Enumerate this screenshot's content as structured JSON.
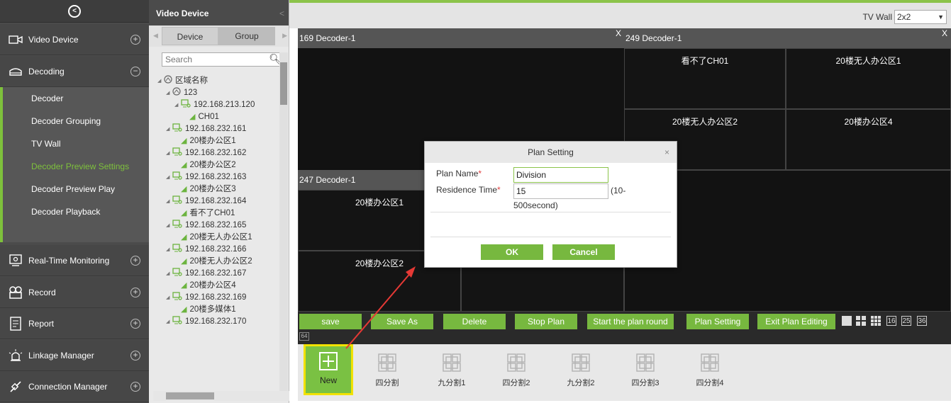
{
  "sidebar": {
    "top_icon": "circle-chevron-icon",
    "sections": [
      {
        "label": "Video Device",
        "icon": "video-device-icon",
        "toggle": "+"
      },
      {
        "label": "Decoding",
        "icon": "decoding-icon",
        "toggle": "−"
      },
      {
        "label": "Real-Time Monitoring",
        "icon": "monitor-icon",
        "toggle": "+"
      },
      {
        "label": "Record",
        "icon": "record-icon",
        "toggle": "+"
      },
      {
        "label": "Report",
        "icon": "report-icon",
        "toggle": "+"
      },
      {
        "label": "Linkage Manager",
        "icon": "linkage-icon",
        "toggle": "+"
      },
      {
        "label": "Connection Manager",
        "icon": "connection-icon",
        "toggle": "+"
      }
    ],
    "sub_items": [
      "Decoder",
      "Decoder Grouping",
      "TV Wall",
      "Decoder Preview Settings",
      "Decoder Preview Play",
      "Decoder Playback"
    ],
    "active_sub": "Decoder Preview Settings",
    "accent_color": "#7ec13c"
  },
  "tree_panel": {
    "title": "Video Device",
    "tabs": [
      "Device",
      "Group"
    ],
    "search_placeholder": "Search",
    "nodes": [
      {
        "label": "区域名称",
        "level": 0,
        "type": "area"
      },
      {
        "label": "123",
        "level": 1,
        "type": "area"
      },
      {
        "label": "192.168.213.120",
        "level": 2,
        "type": "device"
      },
      {
        "label": "CH01",
        "level": 3,
        "type": "camera"
      },
      {
        "label": "192.168.232.161",
        "level": 1,
        "type": "device"
      },
      {
        "label": "20楼办公区1",
        "level": 2,
        "type": "camera"
      },
      {
        "label": "192.168.232.162",
        "level": 1,
        "type": "device"
      },
      {
        "label": "20楼办公区2",
        "level": 2,
        "type": "camera"
      },
      {
        "label": "192.168.232.163",
        "level": 1,
        "type": "device"
      },
      {
        "label": "20楼办公区3",
        "level": 2,
        "type": "camera"
      },
      {
        "label": "192.168.232.164",
        "level": 1,
        "type": "device"
      },
      {
        "label": "看不了CH01",
        "level": 2,
        "type": "camera"
      },
      {
        "label": "192.168.232.165",
        "level": 1,
        "type": "device"
      },
      {
        "label": "20楼无人办公区1",
        "level": 2,
        "type": "camera"
      },
      {
        "label": "192.168.232.166",
        "level": 1,
        "type": "device"
      },
      {
        "label": "20楼无人办公区2",
        "level": 2,
        "type": "camera"
      },
      {
        "label": "192.168.232.167",
        "level": 1,
        "type": "device"
      },
      {
        "label": "20楼办公区4",
        "level": 2,
        "type": "camera"
      },
      {
        "label": "192.168.232.169",
        "level": 1,
        "type": "device"
      },
      {
        "label": "20楼多媒体1",
        "level": 2,
        "type": "camera"
      },
      {
        "label": "192.168.232.170",
        "level": 1,
        "type": "device"
      }
    ]
  },
  "main": {
    "tv_wall_label": "TV Wall",
    "tv_wall_value": "2x2",
    "decoders": [
      {
        "title": "169 Decoder-1",
        "close": "X",
        "cells": []
      },
      {
        "title": "249 Decoder-1",
        "close": "X",
        "cells": [
          "看不了CH01",
          "20楼无人办公区1",
          "20楼无人办公区2",
          "20楼办公区4"
        ]
      },
      {
        "title": "247 Decoder-1",
        "cells": [
          "20楼办公区1",
          "20楼办公区2"
        ]
      }
    ],
    "buttons": [
      "save",
      "Save As",
      "Delete",
      "Stop Plan",
      "Start the plan round",
      "Plan Setting",
      "Exit Plan Editing"
    ],
    "layout_icons": [
      "1",
      "4",
      "9",
      "16",
      "25",
      "36",
      "64"
    ],
    "new_label": "New",
    "plans": [
      "四分割",
      "九分割1",
      "四分割2",
      "九分割2",
      "四分割3",
      "四分割4"
    ]
  },
  "modal": {
    "title": "Plan Setting",
    "close": "×",
    "plan_name_label": "Plan Name",
    "plan_name_value": "Division",
    "residence_label": "Residence Time",
    "residence_value": "15",
    "residence_hint_1": "(10-",
    "residence_hint_2": "500second)",
    "ok": "OK",
    "cancel": "Cancel",
    "required_mark": "*"
  }
}
